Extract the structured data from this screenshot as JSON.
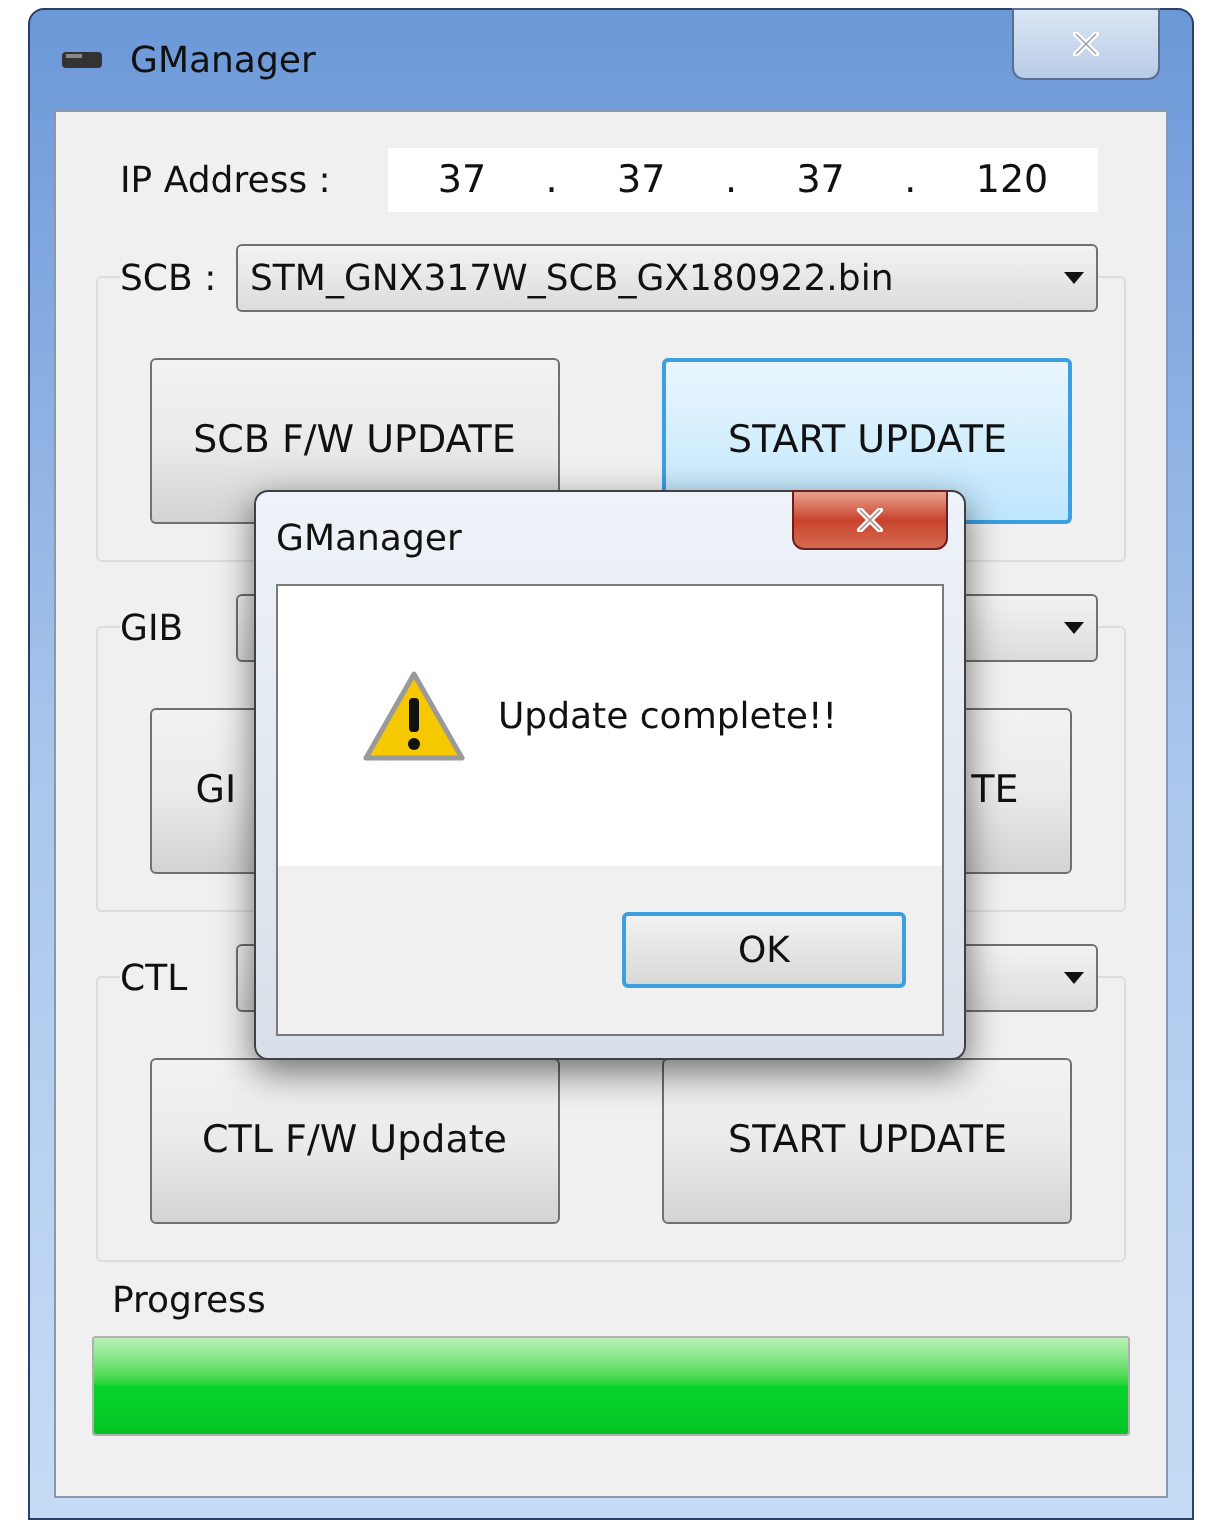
{
  "window": {
    "title": "GManager"
  },
  "ip_address": {
    "label": "IP Address :",
    "parts": [
      "37",
      ".",
      "37",
      ".",
      "37",
      ".",
      "120"
    ]
  },
  "sections": [
    {
      "label": "SCB :",
      "combo_value": "STM_GNX317W_SCB_GX180922.bin",
      "buttons": [
        {
          "label": "SCB F/W UPDATE",
          "kind": "whole",
          "highlighted": false
        },
        {
          "label": "START UPDATE",
          "kind": "whole",
          "highlighted": true
        }
      ]
    },
    {
      "label": "GIB",
      "buttons": [
        {
          "label": "GI",
          "kind": "start",
          "highlighted": false
        },
        {
          "label": "TE",
          "kind": "end",
          "highlighted": false
        }
      ]
    },
    {
      "label": "CTL",
      "buttons": [
        {
          "label": "CTL F/W Update",
          "kind": "whole",
          "highlighted": false
        },
        {
          "label": "START UPDATE",
          "kind": "whole",
          "highlighted": false
        }
      ]
    }
  ],
  "progress": {
    "label": "Progress",
    "level": 1
  },
  "dialog": {
    "title": "GManager",
    "message": "Update complete!!",
    "buttons": [
      {
        "label": "OK",
        "focused": true
      }
    ]
  }
}
